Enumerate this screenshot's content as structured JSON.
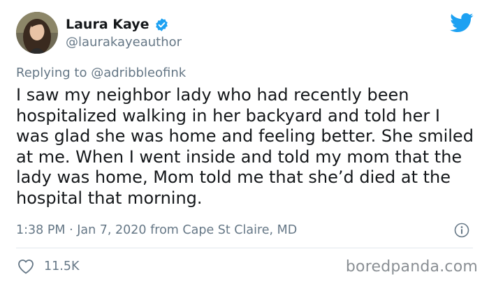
{
  "author": {
    "display_name": "Laura Kaye",
    "handle": "@laurakayeauthor",
    "verified": true
  },
  "reply": {
    "prefix": "Replying to",
    "to_handle": "@adribbleofink"
  },
  "tweet": {
    "text": "I saw my neighbor lady who had recently been hospitalized walking in her backyard and told her I was glad she was home and feeling better. She smiled at me. When I went inside and told my mom that the lady was home, Mom told me that she’d died at the hospital that morning.",
    "meta": "1:38 PM · Jan 7, 2020 from Cape St Claire, MD"
  },
  "engagement": {
    "likes": "11.5K"
  },
  "watermark": "boredpanda.com",
  "icons": {
    "brand": "twitter-bird-icon",
    "verified": "verified-badge-icon",
    "info": "info-icon",
    "like": "heart-icon"
  },
  "colors": {
    "twitter_blue": "#1da1f2",
    "text_primary": "#14171a",
    "text_secondary": "#657786",
    "divider": "#e1e8ed"
  }
}
